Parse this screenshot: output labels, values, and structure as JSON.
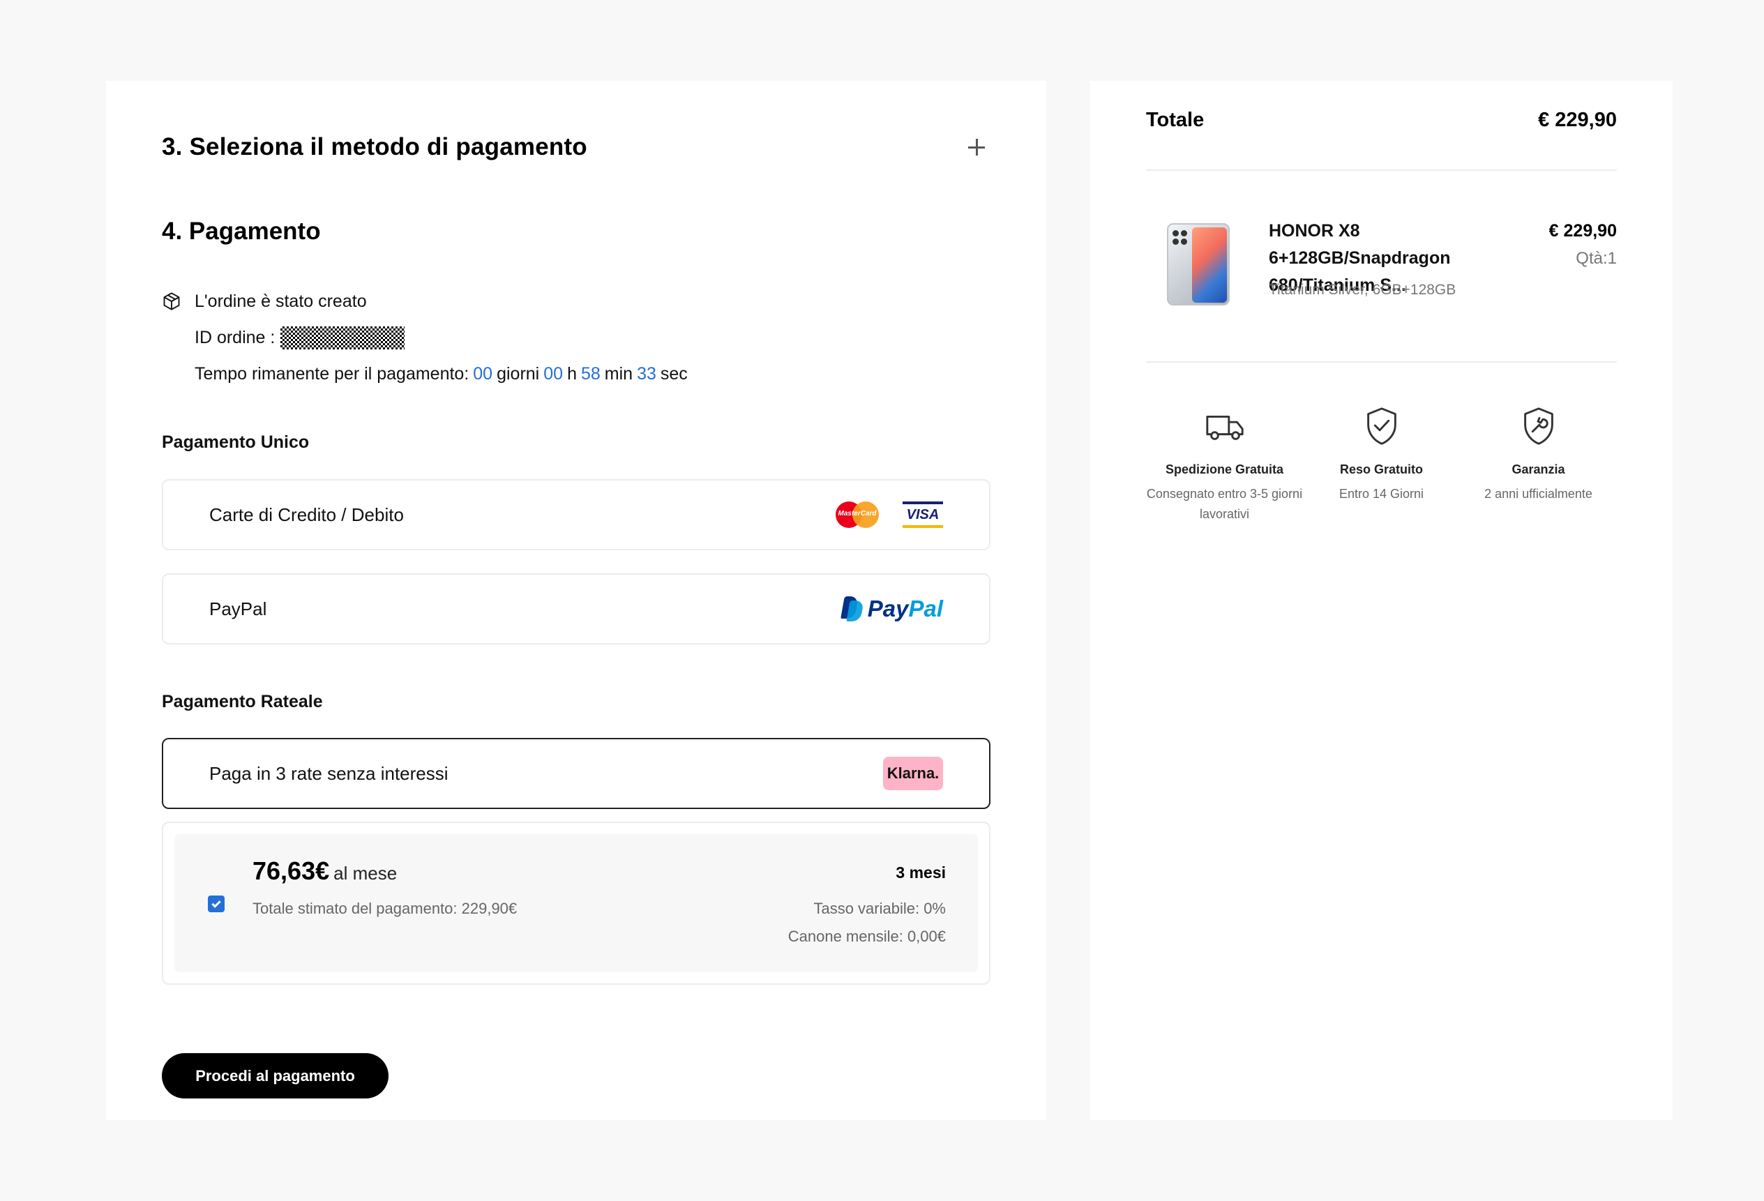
{
  "checkout": {
    "step3_title": "3. Seleziona il metodo di pagamento",
    "step4_title": "4. Pagamento",
    "order": {
      "created_text": "L'ordine è stato creato",
      "id_label": "ID ordine :",
      "time_label": "Tempo rimanente per il pagamento:",
      "days": "00",
      "days_unit": "giorni",
      "hours": "00",
      "hours_unit": "h",
      "minutes": "58",
      "minutes_unit": "min",
      "seconds": "33",
      "seconds_unit": "sec"
    },
    "single_payment_label": "Pagamento Unico",
    "methods": {
      "card_label": "Carte di Credito / Debito",
      "mastercard_text": "MasterCard",
      "visa_text": "VISA",
      "paypal_label": "PayPal",
      "paypal_logo_pay": "Pay",
      "paypal_logo_pal": "Pal"
    },
    "installment_label": "Pagamento Rateale",
    "klarna": {
      "label": "Paga in 3 rate senza interessi",
      "logo_text": "Klarna."
    },
    "installment_plan": {
      "amount": "76,63€",
      "unit": "al mese",
      "total_estimate": "Totale stimato del pagamento: 229,90€",
      "months": "3 mesi",
      "rate": "Tasso variabile: 0%",
      "monthly_fee": "Canone mensile: 0,00€",
      "checked": true
    },
    "proceed_button": "Procedi al pagamento"
  },
  "summary": {
    "total_label": "Totale",
    "total_value": "€ 229,90",
    "product": {
      "name": "HONOR X8 6+128GB/Snapdragon 680/Titanium S...",
      "variant": "Titanium Silver, 6GB+128GB",
      "price": "€ 229,90",
      "qty": "Qtà:1"
    },
    "features": [
      {
        "icon": "truck-icon",
        "title": "Spedizione Gratuita",
        "desc": "Consegnato entro 3-5 giorni lavorativi"
      },
      {
        "icon": "shield-check-icon",
        "title": "Reso Gratuito",
        "desc": "Entro 14 Giorni"
      },
      {
        "icon": "shield-wrench-icon",
        "title": "Garanzia",
        "desc": "2 anni ufficialmente"
      }
    ]
  },
  "colors": {
    "accent_blue": "#256fd8",
    "button_black": "#000000",
    "klarna_pink": "#ffb3c7",
    "page_bg": "#f8f8f8"
  }
}
